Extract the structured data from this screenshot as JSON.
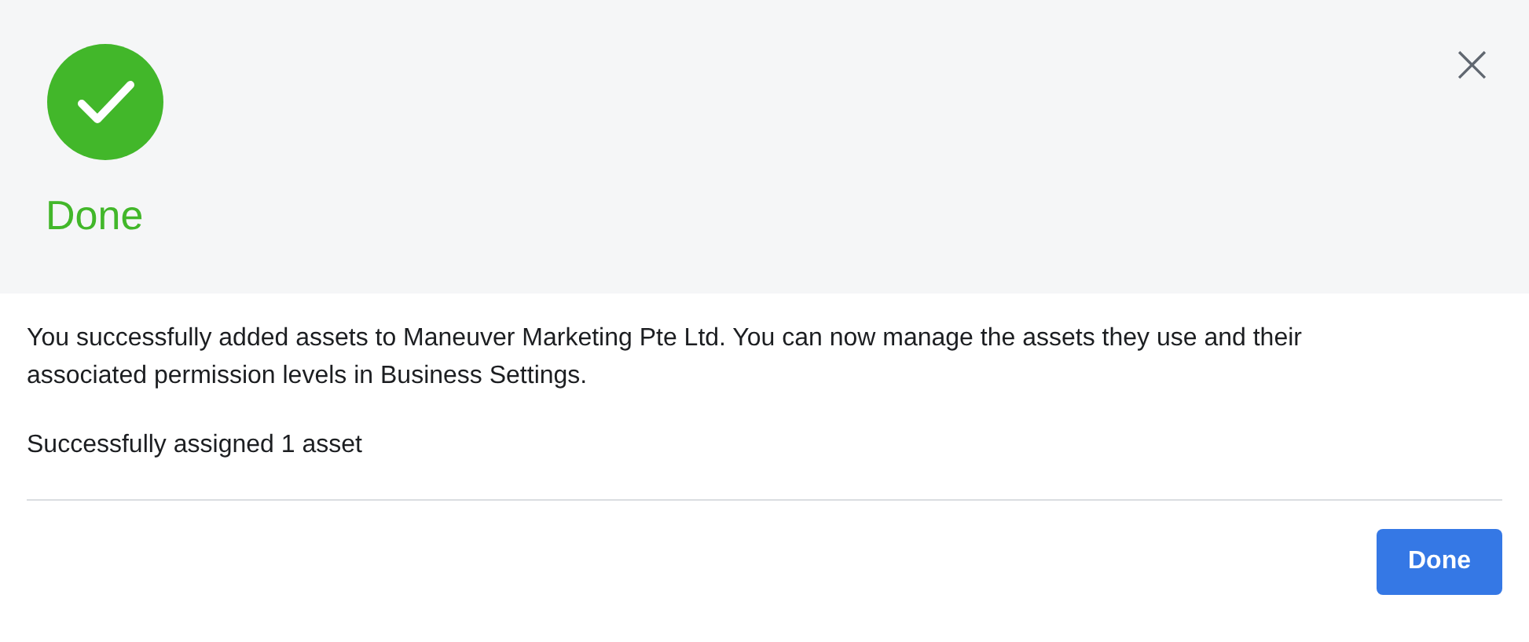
{
  "dialog": {
    "succeeded": true,
    "title": "Done",
    "close": "×",
    "message": "You successfully added assets to Maneuver Marketing Pte Ltd. You can now manage the assets they use and their associated permission levels in Business Settings.",
    "result": "Successfully assigned 1 asset",
    "buttons": [
      {
        "label": "Done",
        "kind": "primary"
      }
    ]
  }
}
